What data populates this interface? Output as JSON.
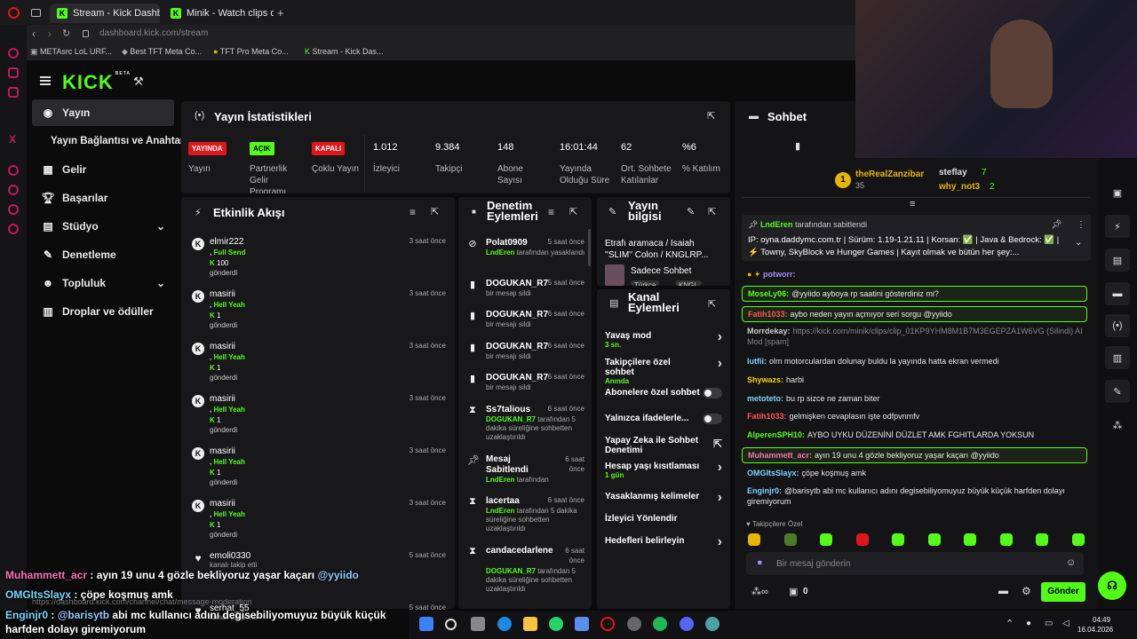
{
  "browser": {
    "tabs": [
      {
        "label": "Stream - Kick Dashboard"
      },
      {
        "label": "Minik - Watch clips on Kick"
      }
    ],
    "new_tab": "+",
    "url_host": "dashboard.kick.com",
    "url_path": "/stream",
    "bookmarks": [
      "METAsrc LoL URF...",
      "Best TFT Meta Co...",
      "TFT Pro Meta Co...",
      "Stream - Kick Das..."
    ]
  },
  "app": {
    "logo": "KICK",
    "beta": "BETA"
  },
  "sidebar": {
    "items": [
      {
        "label": "Yayın",
        "icon": "broadcast-icon"
      },
      {
        "label": "Yayın Bağlantısı ve Anahtarı"
      },
      {
        "label": "Gelir",
        "icon": "money-icon"
      },
      {
        "label": "Başarılar",
        "icon": "trophy-icon"
      },
      {
        "label": "Stüdyo",
        "icon": "studio-icon"
      },
      {
        "label": "Denetleme",
        "icon": "wrench-icon"
      },
      {
        "label": "Topluluk",
        "icon": "people-icon"
      },
      {
        "label": "Droplar ve ödüller",
        "icon": "gift-icon"
      }
    ]
  },
  "stats": {
    "title": "Yayın İstatistikleri",
    "items": [
      {
        "value": "YAYINDA",
        "label": "Yayın",
        "badge_color": "#e0161a"
      },
      {
        "value": "AÇIK",
        "label": "Partnerlik Gelir Programı",
        "badge_color": "#53fc18"
      },
      {
        "value": "KAPALI",
        "label": "Çoklu Yayın",
        "badge_color": "#e0161a"
      },
      {
        "value": "1.012",
        "label": "İzleyici"
      },
      {
        "value": "9.384",
        "label": "Takipçi"
      },
      {
        "value": "148",
        "label": "Abone Sayısı"
      },
      {
        "value": "16:01:44",
        "label": "Yayında Olduğu Süre"
      },
      {
        "value": "62",
        "label": "Ort. Sohbete Katılanlar"
      },
      {
        "value": "%6",
        "label": "% Katılım"
      }
    ]
  },
  "activity": {
    "title": "Etkinlik Akışı",
    "events": [
      {
        "name": "elmir222",
        "action": "Full Send",
        "amount": "100",
        "sent": "gönderdi",
        "time": "3 saat önce"
      },
      {
        "name": "masirii",
        "action": "Hell Yeah",
        "amount": "1",
        "sent": "gönderdi",
        "time": "3 saat önce"
      },
      {
        "name": "masirii",
        "action": "Hell Yeah",
        "amount": "1",
        "sent": "gönderdi",
        "time": "3 saat önce"
      },
      {
        "name": "masirii",
        "action": "Hell Yeah",
        "amount": "1",
        "sent": "gönderdi",
        "time": "3 saat önce"
      },
      {
        "name": "masirii",
        "action": "Hell Yeah",
        "amount": "1",
        "sent": "gönderdi",
        "time": "3 saat önce"
      },
      {
        "name": "masirii",
        "action": "Hell Yeah",
        "amount": "1",
        "sent": "gönderdi",
        "time": "3 saat önce"
      },
      {
        "name": "emoli0330",
        "action": "kanalı takip etti",
        "time": "5 saat önce"
      },
      {
        "name": "serhat_55",
        "action": "kanalı takip etti",
        "time": "5 saat önce"
      }
    ]
  },
  "moderation": {
    "title": "Denetim Eylemleri",
    "items": [
      {
        "name": "Polat0909",
        "actor": "LndEren",
        "desc": "tarafından yasaklandı",
        "time": "5 saat önce",
        "icon": "ban-icon"
      },
      {
        "name": "DOGUKAN_R7",
        "desc": "bir mesajı sildi",
        "time": "5 saat önce",
        "icon": "trash-icon"
      },
      {
        "name": "DOGUKAN_R7",
        "desc": "bir mesajı sildi",
        "time": "6 saat önce",
        "icon": "trash-icon"
      },
      {
        "name": "DOGUKAN_R7",
        "desc": "bir mesajı sildi",
        "time": "6 saat önce",
        "icon": "trash-icon"
      },
      {
        "name": "DOGUKAN_R7",
        "desc": "bir mesajı sildi",
        "time": "6 saat önce",
        "icon": "trash-icon"
      },
      {
        "name": "Ss7talious",
        "actor": "DOGUKAN_R7",
        "desc": "tarafından 5 dakika süreliğine sohbetten uzaklaştırıldı",
        "time": "6 saat önce",
        "icon": "hourglass-icon"
      },
      {
        "name": "Mesaj Sabitlendi",
        "actor": "LndEren",
        "desc": "tarafından",
        "time": "6 saat önce",
        "icon": "pin-icon"
      },
      {
        "name": "lacertaa",
        "actor": "LndEren",
        "desc": "tarafından 5 dakika süreliğine sohbetten uzaklaştırıldı",
        "time": "6 saat önce",
        "icon": "hourglass-icon"
      },
      {
        "name": "candacedarlene",
        "actor": "DOGUKAN_R7",
        "desc": "tarafından 5 dakika süreliğine sohbetten uzaklaştırıldı",
        "time": "6 saat önce",
        "icon": "hourglass-icon"
      }
    ]
  },
  "stream_info": {
    "title": "Yayın bilgisi",
    "stream_title": "Etrafı aramaca / Isaiah ''SLIM'' Colon / KNGLRP...",
    "category": "Sadece Sohbet",
    "tags": [
      "Türkçe",
      "KNGL"
    ]
  },
  "channel": {
    "title": "Kanal Eylemleri",
    "items": [
      {
        "label": "Yavaş mod",
        "sub": "3 sn.",
        "type": "arrow"
      },
      {
        "label": "Takipçilere özel sohbet",
        "sub": "Anında",
        "type": "arrow"
      },
      {
        "label": "Abonelere özel sohbet",
        "type": "toggle"
      },
      {
        "label": "Yalnızca ifadelerle...",
        "type": "toggle"
      },
      {
        "label": "Yapay Zeka ile Sohbet Denetimi",
        "type": "link"
      },
      {
        "label": "Hesap yaşı kısıtlaması",
        "sub": "1 gün",
        "type": "arrow"
      },
      {
        "label": "Yasaklanmış kelimeler",
        "type": "arrow"
      },
      {
        "label": "İzleyici Yönlendir",
        "type": "none"
      },
      {
        "label": "Hedefleri belirleyin",
        "type": "arrow"
      }
    ]
  },
  "chat": {
    "title": "Sohbet",
    "leaders": [
      {
        "name": "theRealZanzibar",
        "count": "35"
      },
      {
        "name": "steflay",
        "count": "7"
      },
      {
        "name": "why_not3",
        "count": "2"
      }
    ],
    "pinned_by": "LndEren",
    "pinned_by_label": "tarafından sabitlendi",
    "pinned_text": "IP: oyna.daddymc.com.tr | Sürüm: 1.19-1.21.11 | Korsan: ✅ | Java & Bedrock: ✅ | ⚡ Towny, SkyBlock ve Hunger Games | Kayıt olmak ve bütün her şey:...",
    "messages": [
      {
        "user": "potworr:",
        "text": "",
        "color": "#a78bfa"
      },
      {
        "user": "MoseLy06:",
        "text": "@yyiido ayboya rp saatini gösterdiniz mi?",
        "color": "#53fc18",
        "hl": true
      },
      {
        "user": "Fatih1033:",
        "text": "aybo neden yayın açmıyor seri sorgu @yyiido",
        "color": "#ff5555",
        "hl": true
      },
      {
        "user": "Morrdekay:",
        "text": "https://kick.com/minik/clips/clip_01KP9YHM8M1B7M3EGEPZA1W6VG (Silindi) AI Mod [spam]",
        "color": "#cccccc"
      },
      {
        "user": "lutfii:",
        "text": "olm motorculardan dolunay buldu la yayında hatta ekran vermedi",
        "color": "#7dd3fc"
      },
      {
        "user": "Shywazs:",
        "text": "harbi",
        "color": "#facc15"
      },
      {
        "user": "metoteto:",
        "text": "bu rp sizce ne zaman biter",
        "color": "#7dd3fc"
      },
      {
        "user": "Fatih1033:",
        "text": "gelmişken cevaplasın işte odfpvnmfv",
        "color": "#ff5555"
      },
      {
        "user": "AlperenSPH10:",
        "text": "AYBO UYKU DÜZENİNİ DÜZLET AMK FGHITLARDA YOKSUN",
        "color": "#53fc18"
      },
      {
        "user": "Muhammett_acr:",
        "text": "ayın 19 unu 4 gözle bekliyoruz yaşar kaçarı @yyiido",
        "color": "#f472b6",
        "hl": true
      },
      {
        "user": "OMGItsSlayx:",
        "text": "çöpe koşmuş amk",
        "color": "#7dd3fc"
      },
      {
        "user": "Enginjr0:",
        "text": "@barisytb abi mc kullanıcı adını degisebiliyomuyuz büyük küçük harfden dolayı giremiyorum",
        "color": "#7dd3fc"
      }
    ],
    "emote_label": "Takipçilere Özel",
    "input_placeholder": "Bir mesaj gönderin",
    "points": "0",
    "send": "Gönder"
  },
  "overlay": [
    {
      "user": "Muhammett_acr",
      "text": " : ayın 19 unu 4 gözle bekliyoruz yaşar kaçarı ",
      "mention": "@yyiido",
      "color": "#f472b6"
    },
    {
      "user": "OMGItsSlayx",
      "text": " : çöpe koşmuş amk",
      "color": "#7dd3fc"
    },
    {
      "user": "Enginjr0",
      "text": " : ",
      "mention": "@barisytb",
      "tail": " abi mc kullanıcı adını degisebiliyomuyuz büyük küçük harfden dolayı giremiyorum",
      "color": "#7dd3fc"
    }
  ],
  "status_url": "https://dashboard.kick.com/channel/chat/message-moderation",
  "taskbar": {
    "time": "04:49",
    "date": "16.04.2026"
  }
}
